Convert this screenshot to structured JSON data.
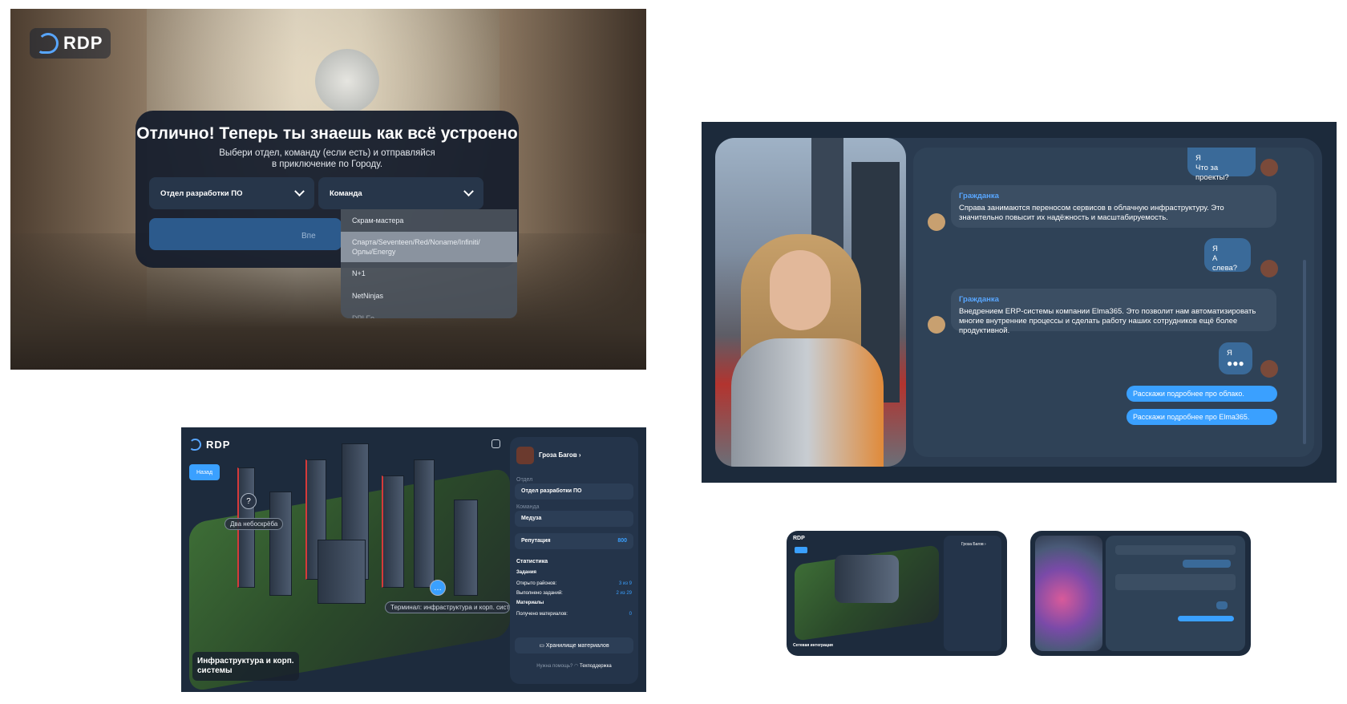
{
  "brand": "RDP",
  "onboarding": {
    "title": "Отлично! Теперь ты знаешь как всё устроено",
    "subtitle_line1": "Выбери отдел, команду (если есть) и отправляйся",
    "subtitle_line2": "в приключение по Городу.",
    "department_select": "Отдел разработки ПО",
    "team_select": "Команда",
    "go_button": "Впе",
    "team_options": [
      "Скрам-мастера",
      "Спарта/Seventeen/Red/Noname/Infiniti/ Орлы/Energy",
      "N+1",
      "NetNinjas",
      "DPI Fo..."
    ]
  },
  "chat": {
    "messages": [
      {
        "from": "Я",
        "text": "Что за проекты?"
      },
      {
        "from": "Гражданка",
        "text": "Справа занимаются переносом сервисов в облачную инфраструктуру. Это значительно повысит их надёжность и масштабируемость."
      },
      {
        "from": "Я",
        "text": "А слева?"
      },
      {
        "from": "Гражданка",
        "text": "Внедрением ERP-системы компании Elma365. Это позволит нам автоматизировать многие внутренние процессы и сделать работу наших сотрудников ещё более продуктивной."
      },
      {
        "from": "Я",
        "text": "●●●"
      }
    ],
    "quick_replies": [
      "Расскажи подробнее про облако.",
      "Расскажи подробнее про Elma365."
    ]
  },
  "map": {
    "back_button": "Назад",
    "tags": [
      "Два небоскрёба",
      "Терминал: инфраструктура и корп. систе"
    ],
    "caption_line1": "Инфраструктура и корп.",
    "caption_line2": "системы",
    "profile": {
      "name": "Гроза Багов ›",
      "department_label": "Отдел",
      "department": "Отдел разработки ПО",
      "team_label": "Команда",
      "team": "Медуза",
      "reputation_label": "Репутация",
      "reputation": "800",
      "stats_title": "Статистика",
      "tasks_title": "Задания",
      "districts_label": "Открыто районов:",
      "districts": "3 из 9",
      "done_label": "Выполнено заданий:",
      "done": "2 из 29",
      "materials_title": "Материалы",
      "materials_label": "Получено материалов:",
      "materials": "0",
      "storage_button": "Хранилище материалов",
      "help_text": "Нужна помощь?",
      "support_link": "Техподдержка"
    }
  },
  "thumb_map": {
    "caption": "Сетевая интеграция",
    "name": "Гроза Багов ›"
  },
  "colors": {
    "accent": "#3aa0ff",
    "panel": "#1d2b3d",
    "card": "#24344a"
  }
}
